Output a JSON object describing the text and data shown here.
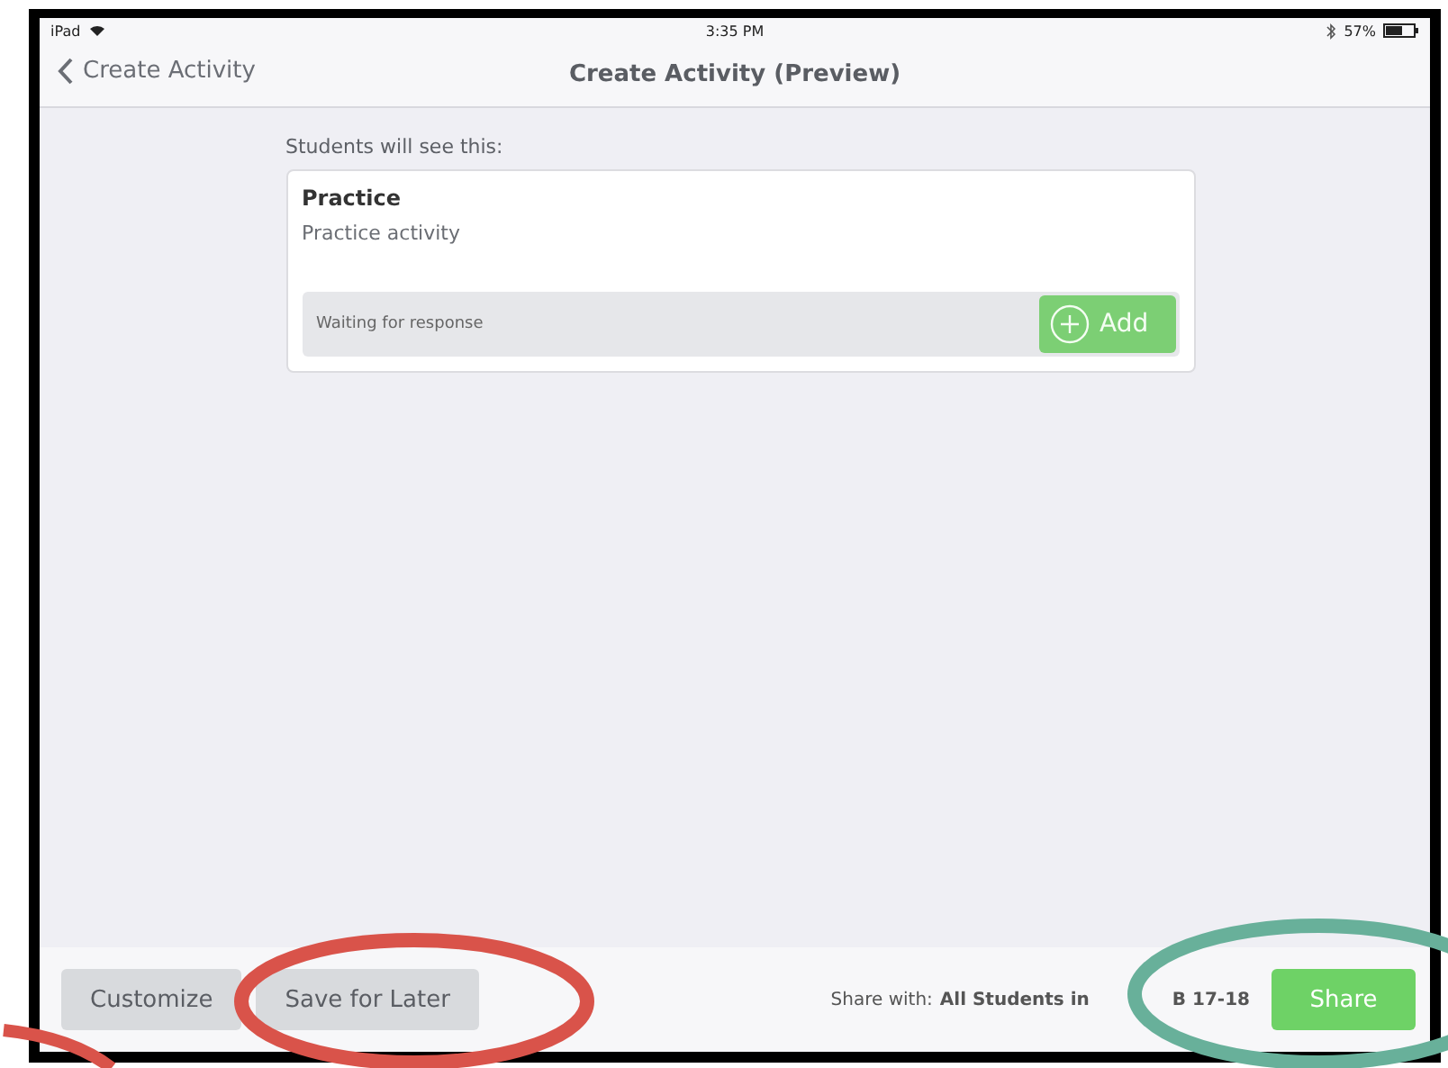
{
  "status_bar": {
    "device": "iPad",
    "time": "3:35 PM",
    "battery": "57%"
  },
  "nav": {
    "back": "Create Activity",
    "title": "Create Activity (Preview)"
  },
  "preview": {
    "label": "Students will see this:",
    "card": {
      "title": "Practice",
      "description": "Practice activity",
      "status": "Waiting for response",
      "add_button": {
        "label": "Add",
        "disabled": true
      }
    }
  },
  "toolbar": {
    "buttons": [
      "Customize",
      "Save for Later"
    ],
    "share_with_label": "Share with:",
    "share_with_target": [
      "All Students in",
      "B 17-18"
    ],
    "share_button": "Share"
  }
}
